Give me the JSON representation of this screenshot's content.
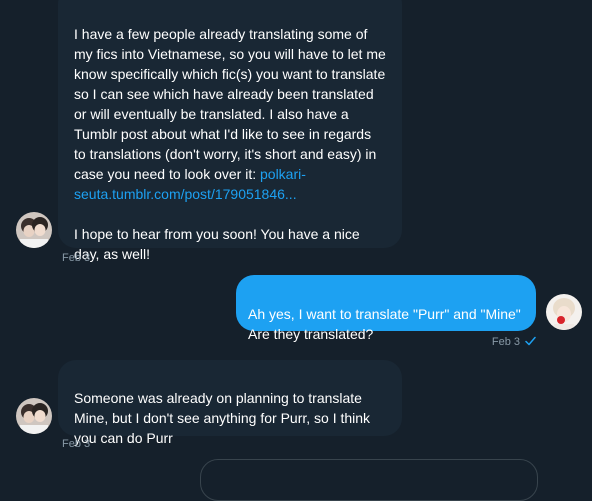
{
  "conversation": {
    "messages": [
      {
        "direction": "incoming",
        "text": "I have a few people already translating some of my fics into Vietnamese, so you will have to let me know specifically which fic(s) you want to translate so I can see which have already been translated or will eventually be translated. I also have a Tumblr post about what I'd like to see in regards to translations (don't worry, it's short and easy) in case you need to look over it: ",
        "link": "polkari-seuta.tumblr.com/post/179051846...",
        "text2": "I hope to hear from you soon! You have a nice day, as well!",
        "timestamp": "Feb 3"
      },
      {
        "direction": "outgoing",
        "text": "Ah yes, I want to translate \"Purr\" and \"Mine\" Are they translated?",
        "timestamp": "Feb 3",
        "status": "read-check-icon"
      },
      {
        "direction": "incoming",
        "text": "Someone was already on planning to translate Mine, but I don't see anything for Purr, so I think you can do Purr",
        "timestamp": "Feb 3"
      }
    ]
  },
  "colors": {
    "background": "#15202b",
    "incoming_bubble": "#192734",
    "outgoing_bubble": "#1da1f2",
    "link": "#1da1f2",
    "meta_text": "#8899a6"
  }
}
